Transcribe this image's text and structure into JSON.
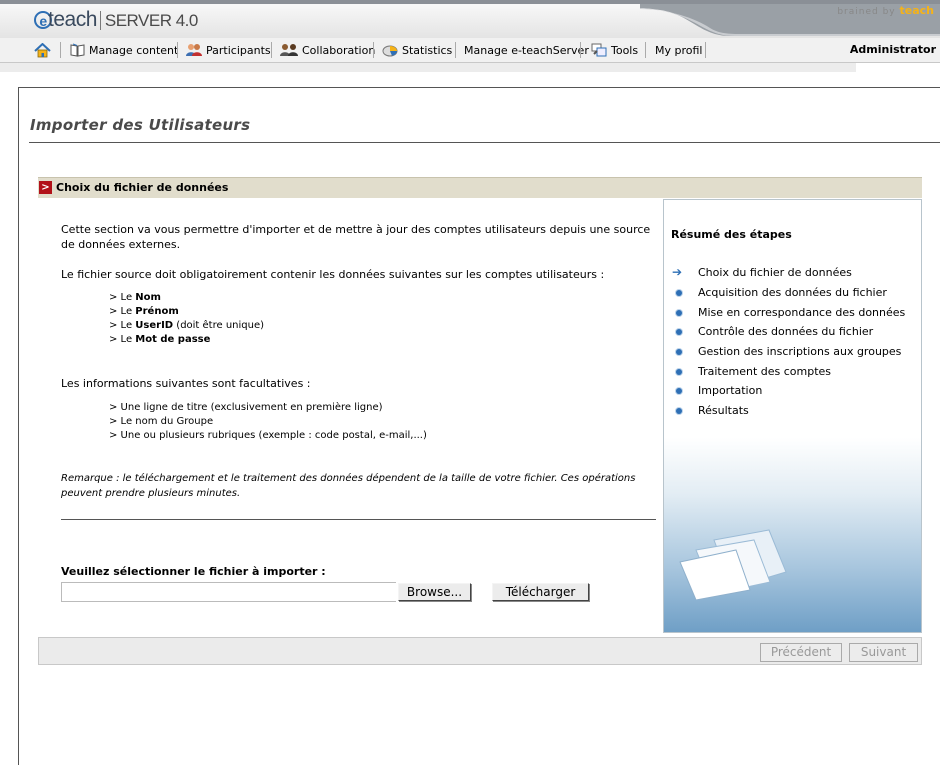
{
  "header": {
    "logo_text": "teach",
    "logo_e": "e",
    "product": "SERVER 4.0",
    "brained_by": "brained by",
    "brained_brand": "teach"
  },
  "nav": {
    "items": [
      {
        "label": "Manage content",
        "icon": "book-icon"
      },
      {
        "label": "Participants",
        "icon": "users-icon"
      },
      {
        "label": "Collaboration",
        "icon": "collaboration-icon"
      },
      {
        "label": "Statistics",
        "icon": "chart-icon"
      },
      {
        "label": "Manage e-teachServer",
        "icon": ""
      },
      {
        "label": "Tools",
        "icon": "tools-icon"
      },
      {
        "label": "My profil",
        "icon": ""
      }
    ],
    "user": "Administrator"
  },
  "page": {
    "title": "Importer des Utilisateurs",
    "section_marker": ">",
    "section_title": "Choix du fichier de données"
  },
  "intro": {
    "p1": "Cette section va vous permettre d'importer et de mettre à jour des comptes utilisateurs depuis une source de données externes.",
    "p2": "Le fichier source doit obligatoirement contenir les données suivantes sur les comptes utilisateurs :",
    "required": [
      {
        "prefix": "> Le ",
        "bold": "Nom",
        "suffix": ""
      },
      {
        "prefix": "> Le ",
        "bold": "Prénom",
        "suffix": ""
      },
      {
        "prefix": "> Le ",
        "bold": "UserID",
        "suffix": " (doit être unique)"
      },
      {
        "prefix": "> Le ",
        "bold": "Mot de passe",
        "suffix": ""
      }
    ],
    "p3": "Les informations suivantes sont facultatives :",
    "optional": [
      "> Une ligne de titre (exclusivement en première ligne)",
      "> Le nom du Groupe",
      "> Une ou plusieurs rubriques (exemple : code postal, e-mail,...)"
    ],
    "note": "Remarque : le téléchargement et le traitement des données dépendent de la taille de votre fichier. Ces opérations peuvent prendre plusieurs minutes."
  },
  "upload": {
    "label": "Veuillez sélectionner le fichier à importer :",
    "file_value": "",
    "browse_label": "Browse...",
    "upload_label": "Télécharger"
  },
  "steps": {
    "title": "Résumé des étapes",
    "items": [
      {
        "label": "Choix du fichier de données",
        "current": true
      },
      {
        "label": "Acquisition des données du fichier",
        "current": false
      },
      {
        "label": "Mise en correspondance des données",
        "current": false
      },
      {
        "label": "Contrôle des données du fichier",
        "current": false
      },
      {
        "label": "Gestion des inscriptions aux groupes",
        "current": false
      },
      {
        "label": "Traitement des comptes",
        "current": false
      },
      {
        "label": "Importation",
        "current": false
      },
      {
        "label": "Résultats",
        "current": false
      }
    ]
  },
  "footer": {
    "prev_label": "Précédent",
    "next_label": "Suivant"
  },
  "colors": {
    "accent": "#2e6fb5",
    "section_bar": "#e1ddcc",
    "marker": "#b2121a",
    "brand_orange": "#f6b317"
  }
}
